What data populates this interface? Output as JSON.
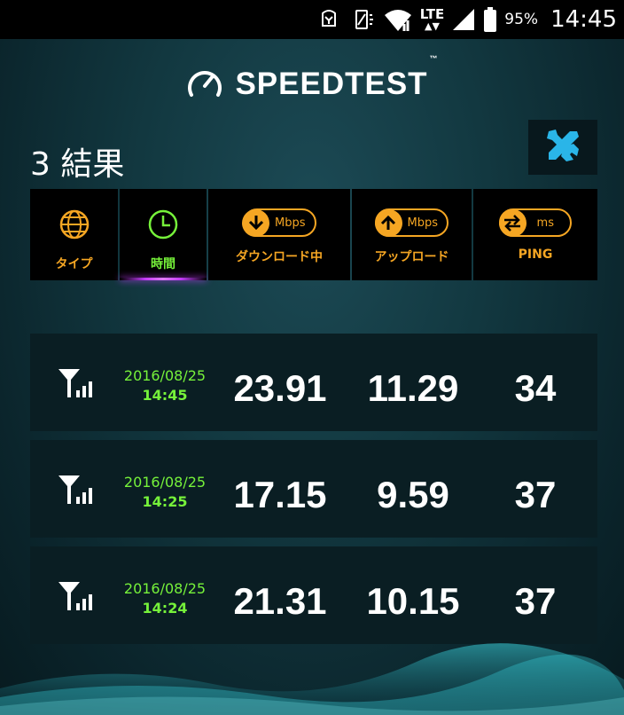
{
  "status_bar": {
    "battery_percent": "95%",
    "time": "14:45",
    "network_type": "LTE",
    "icons": [
      "notification-icon",
      "vibrate-icon",
      "wifi-icon",
      "lte-icon",
      "cellular-signal-icon",
      "battery-icon"
    ]
  },
  "header": {
    "brand": "SPEEDTEST",
    "trademark": "™",
    "results_title": "3 結果"
  },
  "tabs": [
    {
      "label": "タイプ",
      "icon": "globe-icon"
    },
    {
      "label": "時間",
      "icon": "clock-icon",
      "active": true
    },
    {
      "label": "ダウンロード中",
      "icon": "download-arrow-icon",
      "unit": "Mbps"
    },
    {
      "label": "アップロード",
      "icon": "upload-arrow-icon",
      "unit": "Mbps"
    },
    {
      "label": "PING",
      "icon": "ping-arrows-icon",
      "unit": "ms"
    }
  ],
  "results": [
    {
      "date": "2016/08/25",
      "time": "14:45",
      "download": "23.91",
      "upload": "11.29",
      "ping": "34",
      "network": "cellular-icon"
    },
    {
      "date": "2016/08/25",
      "time": "14:25",
      "download": "17.15",
      "upload": "9.59",
      "ping": "37",
      "network": "cellular-icon"
    },
    {
      "date": "2016/08/25",
      "time": "14:24",
      "download": "21.31",
      "upload": "10.15",
      "ping": "37",
      "network": "cellular-icon"
    }
  ],
  "colors": {
    "accent_orange": "#f5a623",
    "accent_green": "#76f23a",
    "active_underline": "#c63cff",
    "tools_icon": "#2ab5e8"
  }
}
